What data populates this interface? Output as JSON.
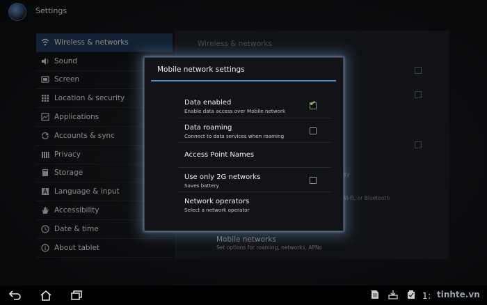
{
  "app": {
    "title": "Settings"
  },
  "sidebar": {
    "items": [
      {
        "label": "Wireless & networks",
        "icon": "wireless-icon",
        "active": true
      },
      {
        "label": "Sound",
        "icon": "speaker-icon"
      },
      {
        "label": "Screen",
        "icon": "screen-icon"
      },
      {
        "label": "Location & security",
        "icon": "location-grid-icon"
      },
      {
        "label": "Applications",
        "icon": "applications-icon"
      },
      {
        "label": "Accounts & sync",
        "icon": "sync-icon"
      },
      {
        "label": "Privacy",
        "icon": "privacy-icon"
      },
      {
        "label": "Storage",
        "icon": "storage-icon"
      },
      {
        "label": "Language & input",
        "icon": "language-icon"
      },
      {
        "label": "Accessibility",
        "icon": "hand-icon"
      },
      {
        "label": "Date & time",
        "icon": "clock-icon"
      },
      {
        "label": "About tablet",
        "icon": "info-icon"
      }
    ]
  },
  "pane": {
    "header": "Wireless & networks",
    "faint_text_1": "lity",
    "faint_text_2": "Wi-Fi, or Bluetooth",
    "mobile_networks": {
      "title": "Mobile networks",
      "subtitle": "Set options for roaming, networks, APNs"
    }
  },
  "dialog": {
    "title": "Mobile network settings",
    "rows": [
      {
        "title": "Data enabled",
        "subtitle": "Enable data access over Mobile network",
        "checked": true
      },
      {
        "title": "Data roaming",
        "subtitle": "Connect to data services when roaming",
        "checked": false
      },
      {
        "title": "Access Point Names"
      },
      {
        "title": "Use only 2G networks",
        "subtitle": "Saves battery",
        "checked": false
      },
      {
        "title": "Network operators",
        "subtitle": "Select a network operator"
      }
    ]
  },
  "statusbar": {
    "clock": "1:",
    "watermark": "tinhte.vn"
  },
  "colors": {
    "accent": "#4d8fd9",
    "active_item": "#1c3550",
    "check_green": "#8dd13a"
  }
}
